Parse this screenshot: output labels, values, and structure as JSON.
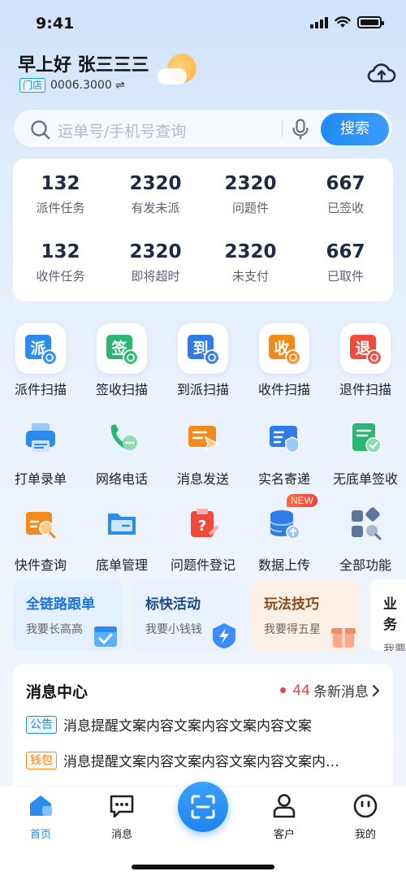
{
  "status_bar": {
    "time": "9:41"
  },
  "header": {
    "greeting": "早上好 张三三三",
    "store_tag": "门店",
    "store_value": "0006.3000 ⇌"
  },
  "search": {
    "placeholder": "运单号/手机号查询",
    "button_label": "搜索"
  },
  "stats": [
    {
      "value": "132",
      "label": "派件任务"
    },
    {
      "value": "2320",
      "label": "有发未派"
    },
    {
      "value": "2320",
      "label": "问题件"
    },
    {
      "value": "667",
      "label": "已签收"
    },
    {
      "value": "132",
      "label": "收件任务"
    },
    {
      "value": "2320",
      "label": "即将超时"
    },
    {
      "value": "2320",
      "label": "未支付"
    },
    {
      "value": "667",
      "label": "已取件"
    }
  ],
  "scan_items": [
    {
      "glyph": "派",
      "label": "派件扫描",
      "color": "#2b8cf0"
    },
    {
      "glyph": "签",
      "label": "签收扫描",
      "color": "#2bb673"
    },
    {
      "glyph": "到",
      "label": "到派扫描",
      "color": "#2f7bea"
    },
    {
      "glyph": "收",
      "label": "收件扫描",
      "color": "#f28a1e"
    },
    {
      "glyph": "退",
      "label": "退件扫描",
      "color": "#ef4b3c"
    }
  ],
  "tools": [
    {
      "label": "打单录单",
      "icon": "printer-icon",
      "color": "#2b8cf0"
    },
    {
      "label": "网络电话",
      "icon": "phone-icon",
      "color": "#2bb673"
    },
    {
      "label": "消息发送",
      "icon": "message-send-icon",
      "color": "#f28a1e"
    },
    {
      "label": "实名寄递",
      "icon": "id-card-icon",
      "color": "#2f7bea"
    },
    {
      "label": "无底单签收",
      "icon": "receipt-check-icon",
      "color": "#2bb673"
    }
  ],
  "more_tools": [
    {
      "label": "快件查询",
      "icon": "parcel-search-icon",
      "color": "#f28a1e"
    },
    {
      "label": "底单管理",
      "icon": "folder-icon",
      "color": "#2b8cf0"
    },
    {
      "label": "问题件登记",
      "icon": "question-clipboard-icon",
      "color": "#ef4b3c"
    },
    {
      "label": "数据上传",
      "icon": "database-upload-icon",
      "color": "#2f7bea",
      "badge": "NEW"
    },
    {
      "label": "全部功能",
      "icon": "all-apps-icon",
      "color": "#5d7699"
    }
  ],
  "promos": [
    {
      "title": "全链路跟单",
      "sub": "我要长高高",
      "title_color": "#1a73d9",
      "bg": "#e4f0ff"
    },
    {
      "title": "标快活动",
      "sub": "我要小钱钱",
      "title_color": "#1f4a8a",
      "bg": "#eaf2ff"
    },
    {
      "title": "玩法技巧",
      "sub": "我要得五星",
      "title_color": "#8a4a1a",
      "bg": "#fdf0e6"
    },
    {
      "title": "业务",
      "sub": "我要",
      "title_color": "#222222",
      "bg": "#ffffff"
    }
  ],
  "messages": {
    "title": "消息中心",
    "count": "44",
    "count_suffix": "条新消息",
    "items": [
      {
        "tag": "公告",
        "text": "消息提醒文案内容文案内容文案内容文案",
        "tag_color": "#1a8fd8"
      },
      {
        "tag": "钱包",
        "text": "消息提醒文案内容文案内容文案内容文案内…",
        "tag_color": "#f28a1e"
      }
    ]
  },
  "tabs": [
    {
      "label": "首页",
      "active": true
    },
    {
      "label": "消息"
    },
    {
      "label": "客户"
    },
    {
      "label": "我的"
    }
  ],
  "colors": {
    "accent": "#1f8cf5",
    "text_primary": "#1f2a44",
    "alert_red": "#f0443b"
  }
}
